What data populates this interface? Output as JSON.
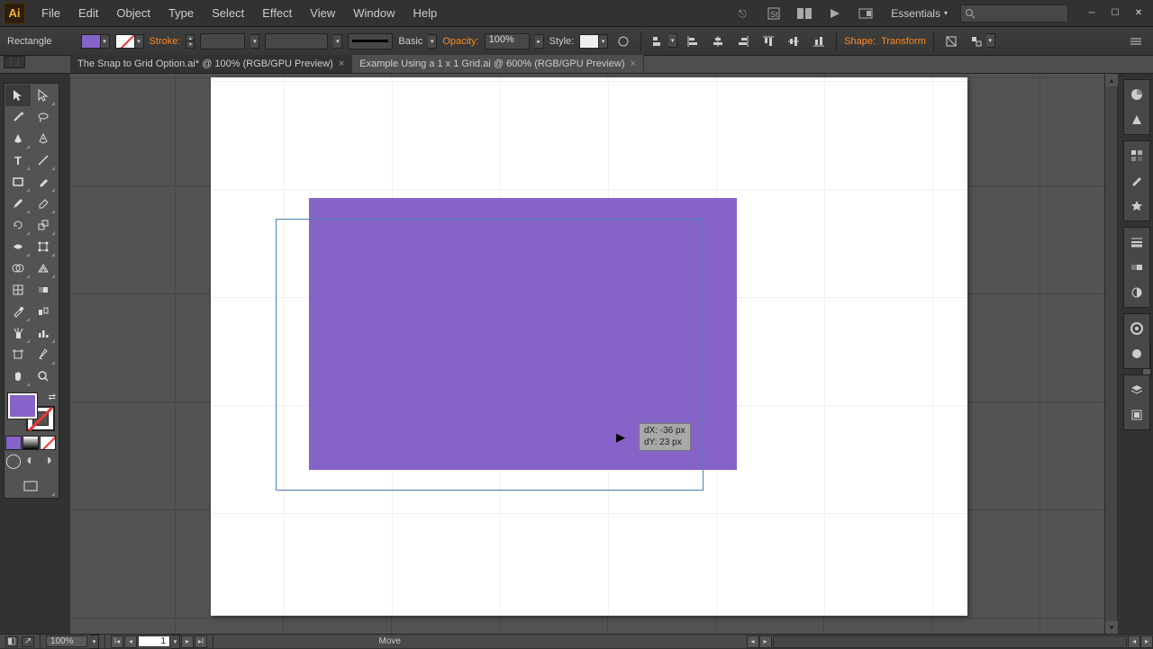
{
  "app": {
    "icon_label": "Ai"
  },
  "menu": [
    "File",
    "Edit",
    "Object",
    "Type",
    "Select",
    "Effect",
    "View",
    "Window",
    "Help"
  ],
  "workspace": {
    "label": "Essentials"
  },
  "controlbar": {
    "selection": "Rectangle",
    "stroke_label": "Stroke:",
    "stroke_weight": "",
    "brush_label": "Basic",
    "opacity_label": "Opacity:",
    "opacity_value": "100%",
    "style_label": "Style:",
    "shape_label": "Shape:",
    "transform_label": "Transform"
  },
  "tabs": [
    {
      "title": "The Snap to Grid Option.ai* @ 100% (RGB/GPU Preview)",
      "active": true
    },
    {
      "title": "Example Using a 1 x 1 Grid.ai @ 600% (RGB/GPU Preview)",
      "active": false
    }
  ],
  "smart_guide": {
    "dx": "dX: -36 px",
    "dy": "dY: 23 px"
  },
  "status": {
    "zoom": "100%",
    "artboard": "1",
    "action": "Move"
  },
  "chart_data": {
    "type": "table",
    "title": "Move smart guide readout",
    "fields": [
      "dX",
      "dY"
    ],
    "values": [
      "-36 px",
      "23 px"
    ]
  }
}
